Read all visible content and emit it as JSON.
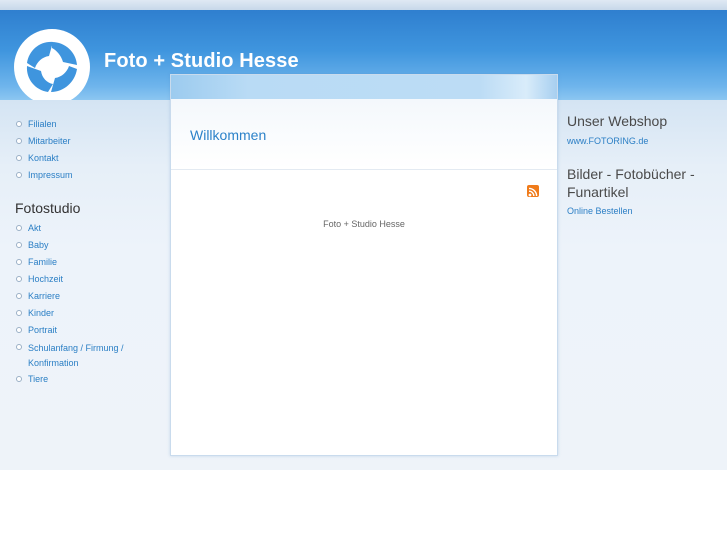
{
  "site": {
    "title": "Foto + Studio Hesse"
  },
  "left_nav": {
    "items": [
      {
        "label": "Filialen"
      },
      {
        "label": "Mitarbeiter"
      },
      {
        "label": "Kontakt"
      },
      {
        "label": "Impressum"
      }
    ]
  },
  "fotostudio": {
    "title": "Fotostudio",
    "items": [
      {
        "label": "Akt"
      },
      {
        "label": "Baby"
      },
      {
        "label": "Familie"
      },
      {
        "label": "Hochzeit"
      },
      {
        "label": "Karriere"
      },
      {
        "label": "Kinder"
      },
      {
        "label": "Portrait"
      },
      {
        "label": "Schulanfang / Firmung / Konfirmation"
      },
      {
        "label": "Tiere"
      }
    ]
  },
  "content": {
    "title": "Willkommen",
    "text": "Foto + Studio Hesse",
    "rss_icon": "rss-icon"
  },
  "right": {
    "webshop_title": "Unser Webshop",
    "webshop_link": "www.FOTORING.de",
    "bilder_title": "Bilder - Fotobücher - Funartikel",
    "bilder_link": "Online Bestellen"
  },
  "colors": {
    "header_blue": "#3f95de",
    "link_blue": "#2b7fc5",
    "rss_orange": "#f07b1a"
  }
}
